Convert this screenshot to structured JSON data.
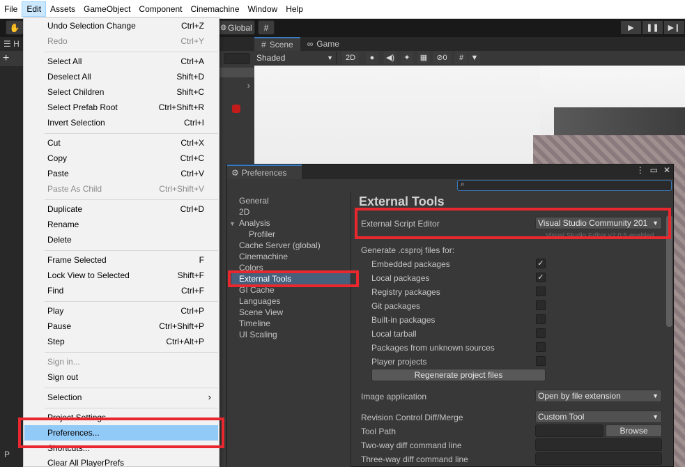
{
  "menubar": [
    "File",
    "Edit",
    "Assets",
    "GameObject",
    "Component",
    "Cinemachine",
    "Window",
    "Help"
  ],
  "toolbar": {
    "global_label": "Global"
  },
  "hierarchy": {
    "tab": "H",
    "bottom": "P"
  },
  "scene": {
    "tabs": [
      "Scene",
      "Game"
    ],
    "shading": "Shaded",
    "mode_2d": "2D",
    "hidden_count": "0"
  },
  "edit_menu": {
    "items": [
      {
        "label": "Undo Selection Change",
        "shortcut": "Ctrl+Z",
        "disabled": false
      },
      {
        "label": "Redo",
        "shortcut": "Ctrl+Y",
        "disabled": true
      },
      {
        "label": "Select All",
        "shortcut": "Ctrl+A",
        "disabled": false
      },
      {
        "label": "Deselect All",
        "shortcut": "Shift+D",
        "disabled": false
      },
      {
        "label": "Select Children",
        "shortcut": "Shift+C",
        "disabled": false
      },
      {
        "label": "Select Prefab Root",
        "shortcut": "Ctrl+Shift+R",
        "disabled": false
      },
      {
        "label": "Invert Selection",
        "shortcut": "Ctrl+I",
        "disabled": false
      },
      {
        "label": "Cut",
        "shortcut": "Ctrl+X",
        "disabled": false
      },
      {
        "label": "Copy",
        "shortcut": "Ctrl+C",
        "disabled": false
      },
      {
        "label": "Paste",
        "shortcut": "Ctrl+V",
        "disabled": false
      },
      {
        "label": "Paste As Child",
        "shortcut": "Ctrl+Shift+V",
        "disabled": true
      },
      {
        "label": "Duplicate",
        "shortcut": "Ctrl+D",
        "disabled": false
      },
      {
        "label": "Rename",
        "shortcut": "",
        "disabled": false
      },
      {
        "label": "Delete",
        "shortcut": "",
        "disabled": false
      },
      {
        "label": "Frame Selected",
        "shortcut": "F",
        "disabled": false
      },
      {
        "label": "Lock View to Selected",
        "shortcut": "Shift+F",
        "disabled": false
      },
      {
        "label": "Find",
        "shortcut": "Ctrl+F",
        "disabled": false
      },
      {
        "label": "Play",
        "shortcut": "Ctrl+P",
        "disabled": false
      },
      {
        "label": "Pause",
        "shortcut": "Ctrl+Shift+P",
        "disabled": false
      },
      {
        "label": "Step",
        "shortcut": "Ctrl+Alt+P",
        "disabled": false
      },
      {
        "label": "Sign in...",
        "shortcut": "",
        "disabled": true
      },
      {
        "label": "Sign out",
        "shortcut": "",
        "disabled": false
      },
      {
        "label": "Selection",
        "shortcut": "",
        "disabled": false
      },
      {
        "label": "Project Settings...",
        "shortcut": "",
        "disabled": false
      },
      {
        "label": "Preferences...",
        "shortcut": "",
        "disabled": false
      },
      {
        "label": "Shortcuts...",
        "shortcut": "",
        "disabled": false
      },
      {
        "label": "Clear All PlayerPrefs",
        "shortcut": "",
        "disabled": false
      }
    ]
  },
  "preferences": {
    "title": "Preferences",
    "nav": [
      {
        "label": "General"
      },
      {
        "label": "2D"
      },
      {
        "label": "Analysis"
      },
      {
        "label": "Profiler"
      },
      {
        "label": "Cache Server (global)"
      },
      {
        "label": "Cinemachine"
      },
      {
        "label": "Colors"
      },
      {
        "label": "External Tools"
      },
      {
        "label": "GI Cache"
      },
      {
        "label": "Languages"
      },
      {
        "label": "Scene View"
      },
      {
        "label": "Timeline"
      },
      {
        "label": "UI Scaling"
      }
    ],
    "content": {
      "heading": "External Tools",
      "script_editor_label": "External Script Editor",
      "script_editor_value": "Visual Studio Community 201",
      "script_editor_note": "Visual Studio Editor v2.0.5 enabled",
      "generate_label": "Generate .csproj files for:",
      "packages": [
        {
          "label": "Embedded packages",
          "checked": true
        },
        {
          "label": "Local packages",
          "checked": true
        },
        {
          "label": "Registry packages",
          "checked": false
        },
        {
          "label": "Git packages",
          "checked": false
        },
        {
          "label": "Built-in packages",
          "checked": false
        },
        {
          "label": "Local tarball",
          "checked": false
        },
        {
          "label": "Packages from unknown sources",
          "checked": false
        },
        {
          "label": "Player projects",
          "checked": false
        }
      ],
      "regenerate_label": "Regenerate project files",
      "image_app_label": "Image application",
      "image_app_value": "Open by file extension",
      "revision_label": "Revision Control Diff/Merge",
      "revision_value": "Custom Tool",
      "tool_path_label": "Tool Path",
      "browse_label": "Browse",
      "two_way_label": "Two-way diff command line",
      "three_way_label": "Three-way diff command line"
    }
  },
  "colors": {
    "highlight": "#e8282e",
    "selection_blue": "#91c9f7",
    "nav_selected": "#46607c"
  }
}
